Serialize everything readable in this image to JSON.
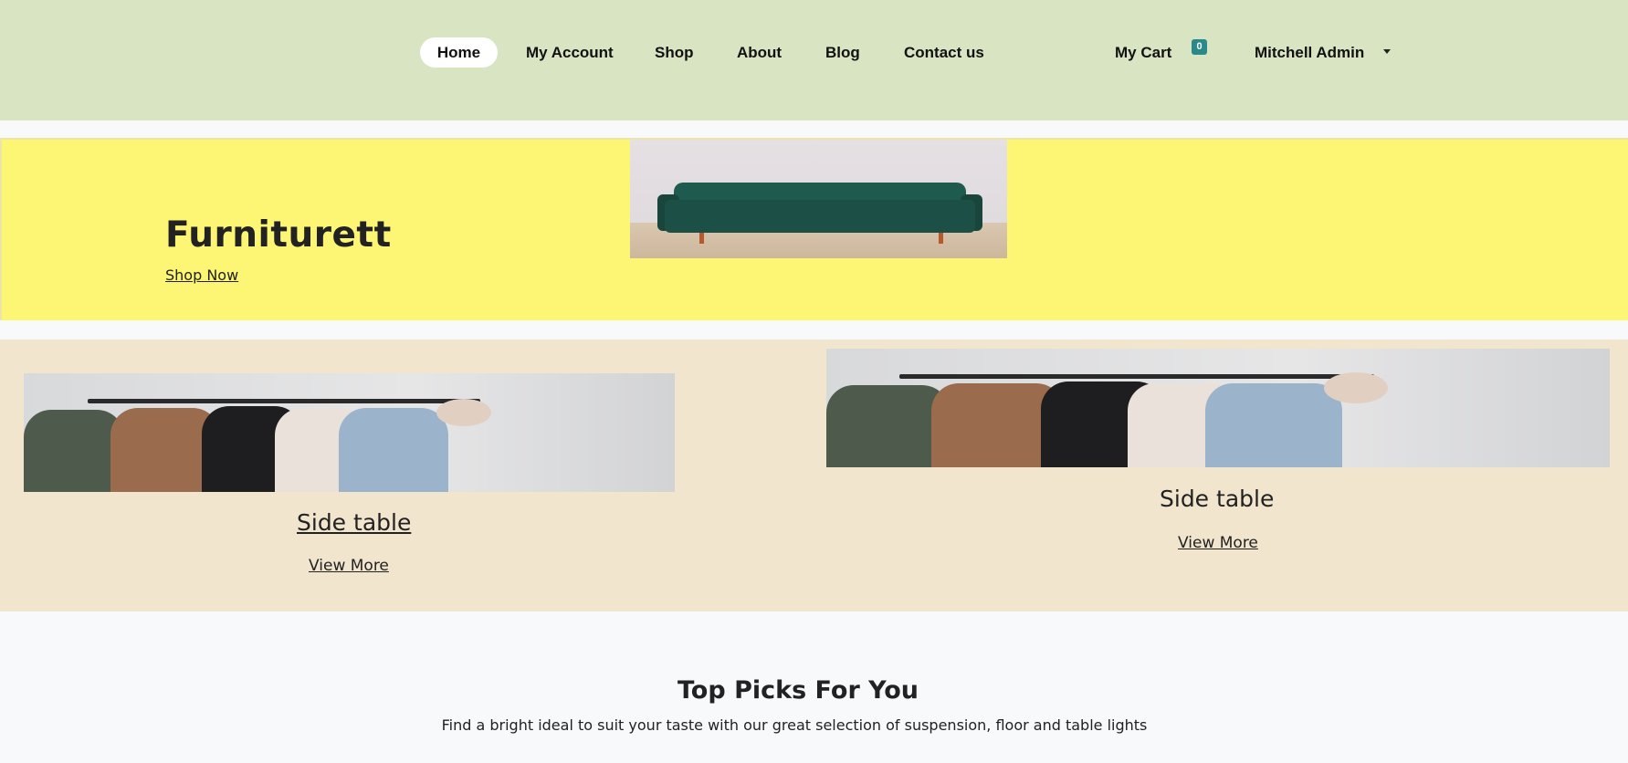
{
  "nav": {
    "items": [
      {
        "label": "Home"
      },
      {
        "label": "My Account"
      },
      {
        "label": "Shop"
      },
      {
        "label": "About"
      },
      {
        "label": "Blog"
      },
      {
        "label": "Contact us"
      }
    ],
    "cart_label": "My Cart",
    "cart_count": "0",
    "user_name": "Mitchell Admin",
    "user_caret_icon": "caret-down-icon"
  },
  "hero": {
    "title": "Furniturett",
    "link_label": "Shop Now",
    "image": "sofa-image"
  },
  "categories": [
    {
      "title": "Side table",
      "link_label": "View More",
      "image": "clothes-rack-image"
    },
    {
      "title": "Side table",
      "link_label": "View More",
      "image": "clothes-rack-image"
    }
  ],
  "top_picks": {
    "title": "Top Picks For You",
    "subtitle": "Find a bright ideal to suit your taste with our great selection of suspension, floor and table lights"
  },
  "colors": {
    "header_bg": "#d8e4c2",
    "hero_bg": "#fcf674",
    "categories_bg": "#f2e5ce",
    "page_bg": "#f8f9fb",
    "badge": "#2a8a8a"
  }
}
